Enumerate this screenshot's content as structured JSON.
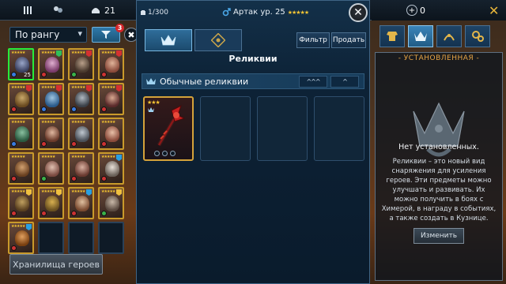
{
  "topbar": {
    "counter_value": "21",
    "icons": [
      "hamburger-icon",
      "social-icon",
      "helmet-icon"
    ]
  },
  "left": {
    "sort_select": "По рангу",
    "filter_count": "3",
    "hero_level_selected": "25",
    "storage_button": "Хранилища героев"
  },
  "modal": {
    "count": "1/300",
    "hero_name": "Артак ур. 25",
    "hero_stars": "★★★★★",
    "filter_button": "Фильтр",
    "sell_button": "Продать",
    "title": "Реликвии",
    "section_label": "Обычные реликвии",
    "sort_up3": "^^^",
    "sort_up1": "^",
    "relic_stars": "★★★"
  },
  "right": {
    "currency_value": "0",
    "header": "- УСТАНОВЛЕННАЯ -",
    "none_installed": "Нет установленных.",
    "description": "Реликвии – это новый вид снаряжения для усиления героев. Эти предметы можно улучшать и развивать. Их можно получить в боях с Химерой, в награду в событиях, а также создать в Кузнице.",
    "change_button": "Изменить"
  },
  "colors": {
    "accent_blue": "#2f79aa",
    "gold_border": "#c99a2b",
    "selected_green": "#27ec3a",
    "header_orange": "#e8a545"
  }
}
